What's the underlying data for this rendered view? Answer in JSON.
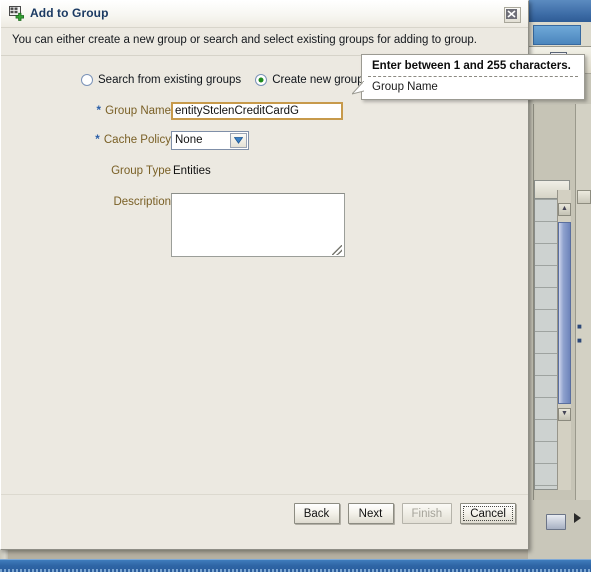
{
  "dialog": {
    "title": "Add to Group",
    "icon": "add-to-group-icon",
    "close_icon": "close-icon",
    "subtitle": "You can either create a new group or search and select existing groups for adding to group.",
    "radio_options": [
      {
        "label": "Search from existing groups",
        "selected": false
      },
      {
        "label": "Create new group",
        "selected": true
      }
    ],
    "fields": {
      "group_name": {
        "label": "Group Name",
        "required_marker": "*",
        "value": "entityStclenCreditCardG",
        "placeholder": ""
      },
      "cache_policy": {
        "label": "Cache Policy",
        "required_marker": "*",
        "value": "None",
        "options": [
          "None"
        ],
        "chevron_icon": "chevron-down-icon"
      },
      "group_type": {
        "label": "Group Type",
        "value": "Entities"
      },
      "description": {
        "label": "Description",
        "value": "",
        "placeholder": ""
      }
    },
    "buttons": [
      {
        "label": "Back",
        "state": "enabled"
      },
      {
        "label": "Next",
        "state": "enabled"
      },
      {
        "label": "Finish",
        "state": "disabled"
      },
      {
        "label": "Cancel",
        "state": "focused"
      }
    ]
  },
  "tooltip": {
    "title": "Enter between 1 and 255 characters.",
    "body": "Group Name"
  },
  "colors": {
    "dialog_background": "#ece9e1",
    "label_text": "#7a6026",
    "required_star": "#2b5fa8",
    "title_text": "#1b3a63",
    "focus_field_border": "#c79a4b",
    "radio_selected": "#1f8a1f",
    "taskbar": "#2f66a6"
  }
}
